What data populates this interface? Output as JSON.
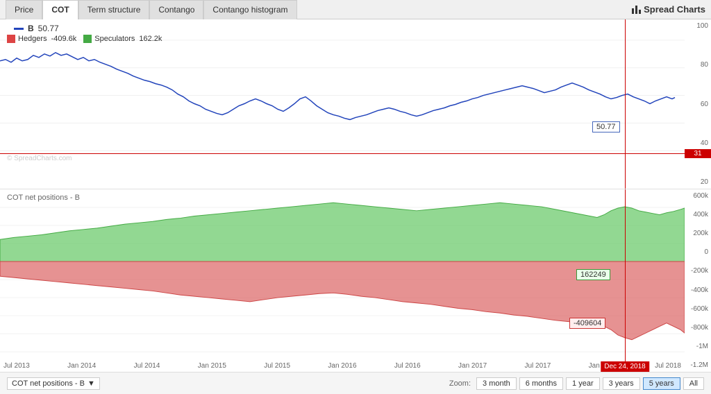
{
  "header": {
    "tabs": [
      {
        "label": "Price",
        "id": "price",
        "active": false
      },
      {
        "label": "COT",
        "id": "cot",
        "active": true
      },
      {
        "label": "Term structure",
        "id": "term",
        "active": false
      },
      {
        "label": "Contango",
        "id": "contango",
        "active": false
      },
      {
        "label": "Contango histogram",
        "id": "contango-hist",
        "active": false
      }
    ],
    "logo": "Spread Charts"
  },
  "price_chart": {
    "symbol": "B",
    "value": "50.77",
    "y_axis": [
      "100",
      "80",
      "60",
      "40",
      "20"
    ],
    "red_line_value": "31",
    "tooltip_value": "50.77"
  },
  "cot_chart": {
    "title": "COT net positions - B",
    "hedgers_label": "Hedgers",
    "hedgers_value": "-409.6k",
    "hedgers_value_exact": "-409604",
    "speculators_label": "Speculators",
    "speculators_value": "162.2k",
    "speculators_value_exact": "162249",
    "y_axis": [
      "600k",
      "400k",
      "200k",
      "0",
      "-200k",
      "-400k",
      "-600k",
      "-800k",
      "-1M",
      "-1.2M"
    ]
  },
  "x_axis_labels": [
    "Jul 2013",
    "Jan 2014",
    "Jul 2014",
    "Jan 2015",
    "Jul 2015",
    "Jan 2016",
    "Jul 2016",
    "Jan 2017",
    "Jul 2017",
    "Jan 2018",
    "Jul 2018"
  ],
  "bottom_bar": {
    "dropdown_label": "COT net positions - B",
    "zoom_label": "Zoom:",
    "zoom_options": [
      "3 month",
      "6 months",
      "1 year",
      "3 years",
      "5 years",
      "All"
    ],
    "active_zoom": "5 years",
    "date_label": "Dec 24, 2018"
  },
  "watermark": "© SpreadCharts.com",
  "colors": {
    "accent_blue": "#2244bb",
    "hedgers_red": "#e88080",
    "speculators_green": "#88cc88",
    "red_line": "#cc0000",
    "active_tab_bg": "#ffffff",
    "tab_bg": "#e0e0e0"
  }
}
